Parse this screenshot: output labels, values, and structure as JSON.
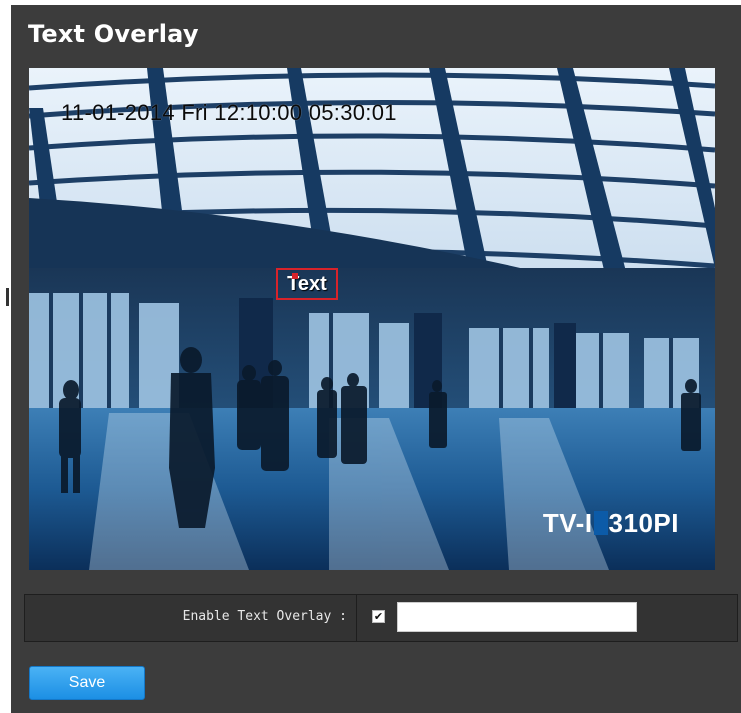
{
  "page": {
    "title": "Text Overlay"
  },
  "video": {
    "timestamp": "11-01-2014 Fri 12:10:00 05:30:01",
    "overlay_text": "Text",
    "camera_model_prefix": "TV-I",
    "camera_model_suffix": "310PI"
  },
  "settings": {
    "enable_label": "Enable Text Overlay :",
    "enabled": true,
    "overlay_value": "",
    "checkbox_glyph": "✔"
  },
  "actions": {
    "save_label": "Save"
  },
  "colors": {
    "panel_bg": "#3c3c3c",
    "accent_blue": "#1c8fe4",
    "overlay_border": "#d8232a"
  }
}
